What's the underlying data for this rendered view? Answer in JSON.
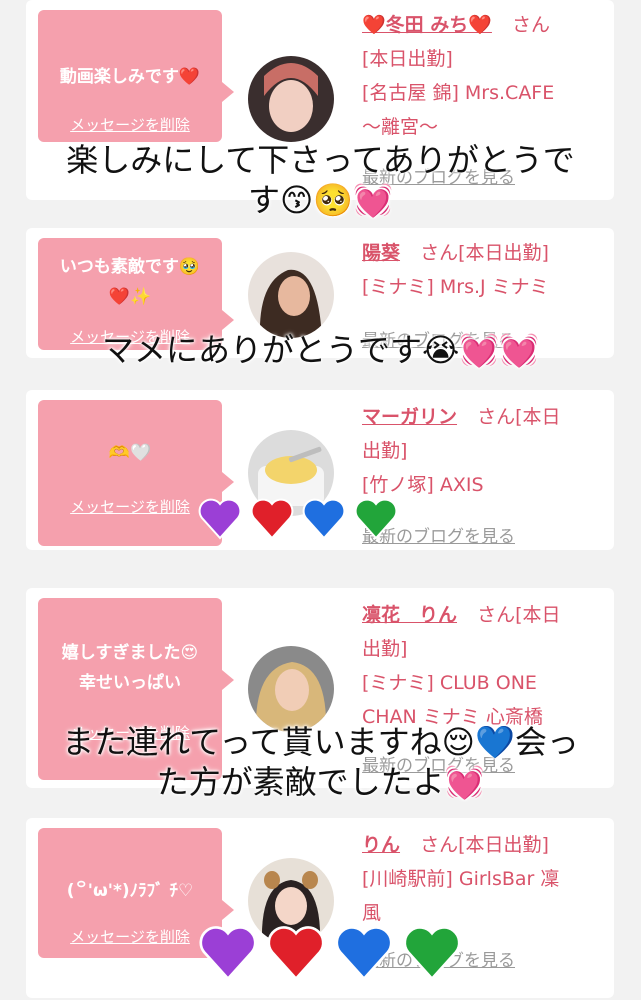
{
  "cards": [
    {
      "message": "動画楽しみです❤️",
      "delete_label": "メッセージを削除",
      "name": "❤️冬田 みち❤️",
      "san": "さん",
      "detail": "[本日出勤]\n[名古屋 錦] Mrs.CAFE\n〜離宮〜",
      "blog": "最新のブログを見る"
    },
    {
      "message": "いつも素敵です🥹\n❤️✨",
      "delete_label": "メッセージを削除",
      "name": "陽葵",
      "san": "さん[本日出勤]",
      "detail": "[ミナミ] Mrs.J ミナミ",
      "blog": "最新のブログを見る"
    },
    {
      "message": "🫶🤍",
      "delete_label": "メッセージを削除",
      "name": "マーガリン",
      "san": "さん[本日\n出勤]",
      "detail": "[竹ノ塚] AXIS",
      "blog": "最新のブログを見る"
    },
    {
      "message": "嬉しすぎました😍\n幸せいっぱい",
      "delete_label": "メッセージを削除",
      "name": "凛花　りん",
      "san": "さん[本日\n出勤]",
      "detail": "[ミナミ] CLUB ONE\nCHAN ミナミ 心斎橋",
      "blog": "最新のブログを見る"
    },
    {
      "message": "(꒪'ω'*)ﾉﾗﾌﾞ ﾁ♡",
      "delete_label": "メッセージを削除",
      "name": "りん",
      "san": "さん[本日出勤]",
      "detail": "[川崎駅前] GirlsBar 凜\n風",
      "blog": "最新のブログを見る"
    }
  ],
  "overlays": [
    "楽しみにして下さってありがとうで\nす😙🥺💓",
    "マメにありがとうです😭💓💓",
    "また連れてって貰いますね😌💙会っ\nた方が素敵でしたよ💓"
  ],
  "heart_colors": [
    "#9b3fd6",
    "#e0202a",
    "#1f6fe0",
    "#22a53a"
  ]
}
